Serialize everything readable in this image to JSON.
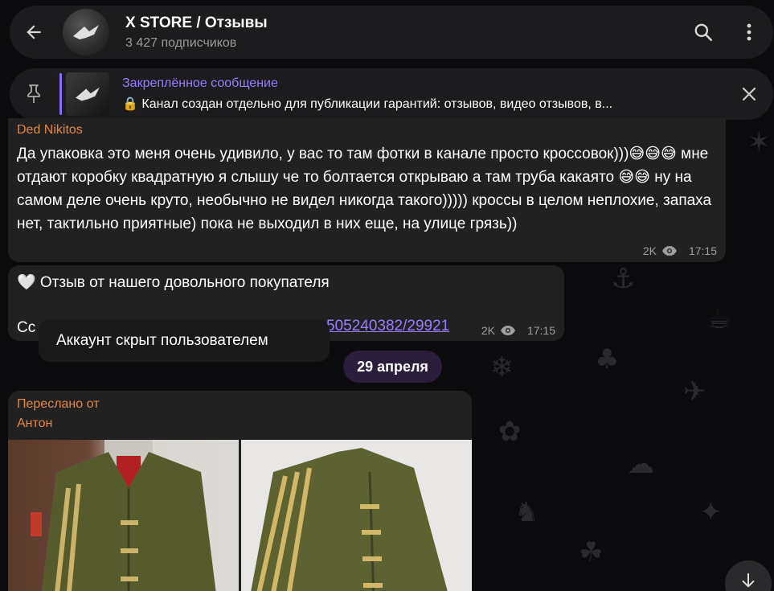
{
  "header": {
    "title": "X STORE / Отзывы",
    "subtitle": "3 427 подписчиков"
  },
  "pinned": {
    "title": "Закреплённое сообщение",
    "message": "🔒 Канал создан отдельно для публикации гарантий: отзывов, видео отзывов, в..."
  },
  "messages": [
    {
      "author": "Ded Nikitos",
      "text": "Да упаковка это меня очень удивило, у вас то там фотки в канале просто кроссовок)))😅😅😅 мне отдают коробку квадратную я слышу че то болтается открываю а там труба какаято 😅😅 ну на самом деле очень круто, необычно не видел никогда такого))))) кроссы в целом неплохие, запаха нет, тактильно приятные) пока не выходил в них еще, на улице грязь))",
      "views": "2K",
      "time": "17:15"
    },
    {
      "text": "🤍 Отзыв от нашего довольного покупателя",
      "link_prefix": "Сс",
      "link": "505240382/29921",
      "views": "2K",
      "time": "17:15"
    },
    {
      "forwarded_label": "Переслано от",
      "forwarded_name": "Антон"
    }
  ],
  "tooltip": "Аккаунт скрыт пользователем",
  "date_pill": "29 апреля",
  "colors": {
    "accent": "#9a7cff",
    "author": "#e4883d",
    "bubble": "#212121",
    "header_bg": "#1c1c1e"
  }
}
